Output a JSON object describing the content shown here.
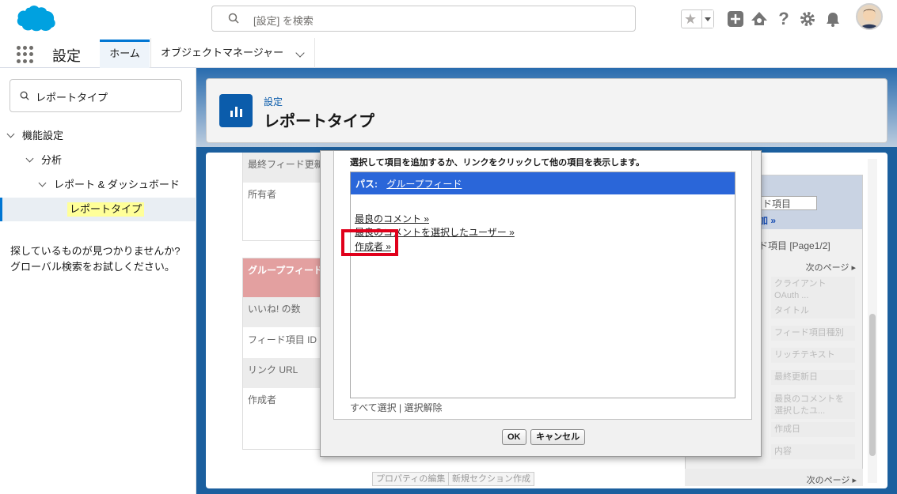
{
  "header": {
    "search_placeholder": "[設定] を検索"
  },
  "nav": {
    "app_name": "設定",
    "tabs": [
      {
        "label": "ホーム"
      },
      {
        "label": "オブジェクトマネージャー"
      }
    ]
  },
  "sidebar": {
    "search_value": "レポートタイプ",
    "tree": [
      {
        "label": "機能設定"
      },
      {
        "label": "分析"
      },
      {
        "label": "レポート & ダッシュボード"
      },
      {
        "label": "レポートタイプ"
      }
    ],
    "help_line1": "探しているものが見つかりませんか?",
    "help_line2": "グローバル検索をお試しください。"
  },
  "page_header": {
    "breadcrumb": "設定",
    "title": "レポートタイプ"
  },
  "background": {
    "left_fields_top": [
      "最終フィード更新",
      "所有者"
    ],
    "section_header": "グループフィード",
    "left_fields": [
      "いいね! の数",
      "フィード項目 ID",
      "リンク URL",
      "作成者"
    ],
    "right_select": "ド項目",
    "right_link": "加 »",
    "right_page": "ド項目 [Page1/2]",
    "next_page": "次のページ",
    "right_fields": [
      "クライアント OAuth ...",
      "タイトル",
      "フィード項目種別",
      "リッチテキスト",
      "最終更新日",
      "最良のコメントを選択したユ...",
      "作成日",
      "内容"
    ],
    "btn_props": "プロパティの編集",
    "btn_newsec": "新規セクション作成",
    "next_page_bottom": "次のページ"
  },
  "modal": {
    "instruction": "選択して項目を追加するか、リンクをクリックして他の項目を表示します。",
    "path_label": "パス:",
    "path_link": "グループフィード",
    "items": [
      "最良のコメント »",
      "最良のコメントを選択したユーザー »",
      "作成者 »"
    ],
    "select_all": "すべて選択",
    "separator": "|",
    "deselect_all": "選択解除",
    "ok": "OK",
    "cancel": "キャンセル"
  },
  "colors": {
    "brand": "#00a1e0",
    "accent": "#0176d3",
    "highlight": "#e0001b",
    "path_bar": "#2a66d9"
  }
}
